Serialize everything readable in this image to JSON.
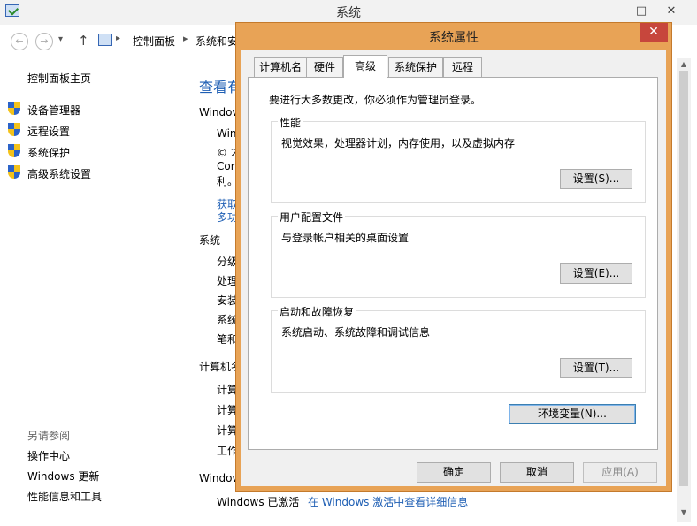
{
  "background_window": {
    "title": "系统",
    "controls": {
      "minimize": "—",
      "maximize": "□",
      "close": "✕"
    },
    "nav": {
      "back": "←",
      "forward": "→",
      "dropdown": "▾",
      "up": "↑"
    },
    "breadcrumb": [
      "控制面板",
      "系统和安"
    ],
    "left_panel": {
      "home": "控制面板主页",
      "links": [
        "设备管理器",
        "远程设置",
        "系统保护",
        "高级系统设置"
      ],
      "see_also_title": "另请参阅",
      "see_also_links": [
        "操作中心",
        "Windows 更新",
        "性能信息和工具"
      ]
    },
    "main": {
      "heading": "查看有",
      "edition_title": "Window",
      "edition_name": "Win",
      "copyright_line1": "© 2",
      "copyright_line2": "Cor",
      "copyright_line3": "利。",
      "link_get": "获取",
      "link_more": "多功",
      "system_title": "系统",
      "system_rows": [
        "分级",
        "处理",
        "安装",
        "系统",
        "笔和"
      ],
      "computer_title": "计算机名",
      "computer_rows": [
        "计算",
        "计算",
        "计算",
        "工作"
      ],
      "activation_title": "Window",
      "activation_status": "Windows 已激活",
      "activation_link": "在 Windows 激活中查看详细信息"
    },
    "scrollbar": {
      "up": "▲",
      "down": "▼"
    }
  },
  "dialog": {
    "title": "系统属性",
    "close": "✕",
    "tabs": [
      "计算机名",
      "硬件",
      "高级",
      "系统保护",
      "远程"
    ],
    "active_tab": "高级",
    "admin_note": "要进行大多数更改，你必须作为管理员登录。",
    "groups": [
      {
        "label": "性能",
        "description": "视觉效果，处理器计划，内存使用，以及虚拟内存",
        "button": "设置(S)..."
      },
      {
        "label": "用户配置文件",
        "description": "与登录帐户相关的桌面设置",
        "button": "设置(E)..."
      },
      {
        "label": "启动和故障恢复",
        "description": "系统启动、系统故障和调试信息",
        "button": "设置(T)..."
      }
    ],
    "env_button": "环境变量(N)...",
    "ok": "确定",
    "cancel": "取消",
    "apply": "应用(A)"
  },
  "colors": {
    "dialog_frame": "#e8a356",
    "close_button": "#c7463c",
    "link": "#1f5fb4"
  }
}
